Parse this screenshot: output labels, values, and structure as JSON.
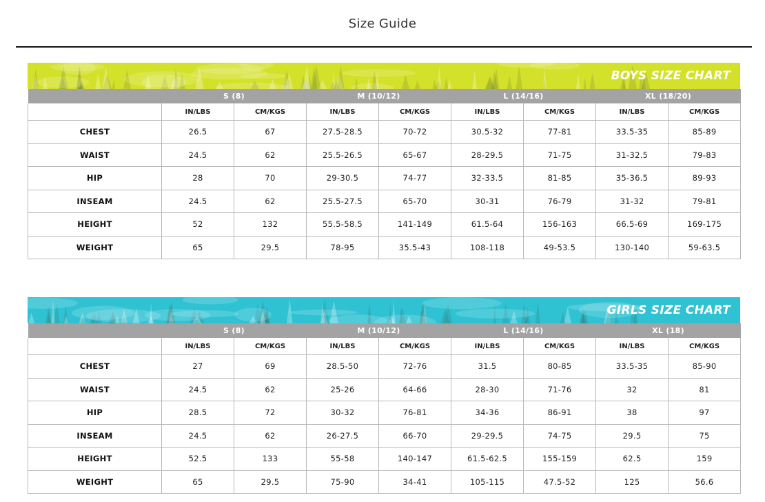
{
  "page": {
    "title": "Size Guide"
  },
  "charts": [
    {
      "banner": "BOYS SIZE CHART",
      "color": "#d4e12a",
      "sizes": [
        "S (8)",
        "M (10/12)",
        "L (14/16)",
        "XL (18/20)"
      ],
      "units": [
        "IN/LBS",
        "CM/KGS",
        "IN/LBS",
        "CM/KGS",
        "IN/LBS",
        "CM/KGS",
        "IN/LBS",
        "CM/KGS"
      ],
      "rows": [
        {
          "label": "CHEST",
          "values": [
            "26.5",
            "67",
            "27.5-28.5",
            "70-72",
            "30.5-32",
            "77-81",
            "33.5-35",
            "85-89"
          ]
        },
        {
          "label": "WAIST",
          "values": [
            "24.5",
            "62",
            "25.5-26.5",
            "65-67",
            "28-29.5",
            "71-75",
            "31-32.5",
            "79-83"
          ]
        },
        {
          "label": "HIP",
          "values": [
            "28",
            "70",
            "29-30.5",
            "74-77",
            "32-33.5",
            "81-85",
            "35-36.5",
            "89-93"
          ]
        },
        {
          "label": "INSEAM",
          "values": [
            "24.5",
            "62",
            "25.5-27.5",
            "65-70",
            "30-31",
            "76-79",
            "31-32",
            "79-81"
          ]
        },
        {
          "label": "HEIGHT",
          "values": [
            "52",
            "132",
            "55.5-58.5",
            "141-149",
            "61.5-64",
            "156-163",
            "66.5-69",
            "169-175"
          ]
        },
        {
          "label": "WEIGHT",
          "values": [
            "65",
            "29.5",
            "78-95",
            "35.5-43",
            "108-118",
            "49-53.5",
            "130-140",
            "59-63.5"
          ]
        }
      ]
    },
    {
      "banner": "GIRLS SIZE CHART",
      "color": "#2ec2d3",
      "sizes": [
        "S (8)",
        "M (10/12)",
        "L (14/16)",
        "XL (18)"
      ],
      "units": [
        "IN/LBS",
        "CM/KGS",
        "IN/LBS",
        "CM/KGS",
        "IN/LBS",
        "CM/KGS",
        "IN/LBS",
        "CM/KGS"
      ],
      "rows": [
        {
          "label": "CHEST",
          "values": [
            "27",
            "69",
            "28.5-50",
            "72-76",
            "31.5",
            "80-85",
            "33.5-35",
            "85-90"
          ]
        },
        {
          "label": "WAIST",
          "values": [
            "24.5",
            "62",
            "25-26",
            "64-66",
            "28-30",
            "71-76",
            "32",
            "81"
          ]
        },
        {
          "label": "HIP",
          "values": [
            "28.5",
            "72",
            "30-32",
            "76-81",
            "34-36",
            "86-91",
            "38",
            "97"
          ]
        },
        {
          "label": "INSEAM",
          "values": [
            "24.5",
            "62",
            "26-27.5",
            "66-70",
            "29-29.5",
            "74-75",
            "29.5",
            "75"
          ]
        },
        {
          "label": "HEIGHT",
          "values": [
            "52.5",
            "133",
            "55-58",
            "140-147",
            "61.5-62.5",
            "155-159",
            "62.5",
            "159"
          ]
        },
        {
          "label": "WEIGHT",
          "values": [
            "65",
            "29.5",
            "75-90",
            "34-41",
            "105-115",
            "47.5-52",
            "125",
            "56.6"
          ]
        }
      ]
    }
  ]
}
